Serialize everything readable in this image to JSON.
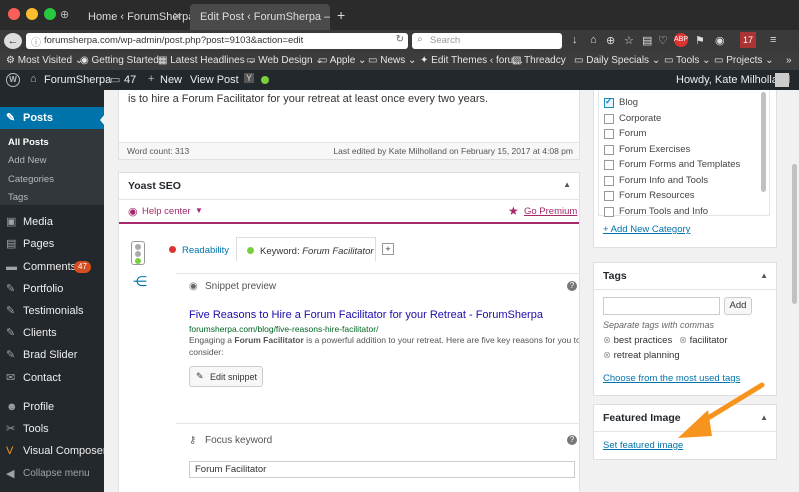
{
  "browser": {
    "tabs": [
      {
        "title": "Home ‹ ForumSherpa",
        "active": false
      },
      {
        "title": "Edit Post ‹ ForumSherpa — Wo…",
        "active": true
      }
    ],
    "url": "forumsherpa.com/wp-admin/post.php?post=9103&action=edit",
    "search_placeholder": "Search",
    "bookmarks": [
      "Most Visited",
      "Getting Started",
      "Latest Headlines",
      "Web Design",
      "Apple",
      "News",
      "Edit Themes ‹ foru…",
      "Threadcy",
      "Daily Specials",
      "Tools",
      "Projects"
    ]
  },
  "adminbar": {
    "site_name": "ForumSherpa",
    "comment_count": "47",
    "new_label": "New",
    "view_post": "View Post",
    "greeting": "Howdy, Kate Milholland"
  },
  "menu": {
    "posts": "Posts",
    "posts_sub": [
      "All Posts",
      "Add New",
      "Categories",
      "Tags"
    ],
    "media": "Media",
    "pages": "Pages",
    "comments": "Comments",
    "comments_badge": "47",
    "portfolio": "Portfolio",
    "testimonials": "Testimonials",
    "clients": "Clients",
    "brad_slider": "Brad Slider",
    "contact": "Contact",
    "profile": "Profile",
    "tools": "Tools",
    "visual_composer": "Visual Composer",
    "collapse": "Collapse menu"
  },
  "editor": {
    "body_line": "is to hire a Forum Facilitator for your retreat at least once every two years.",
    "word_count": "Word count: 313",
    "last_edited": "Last edited by Kate Milholland on February 15, 2017 at 4:08 pm"
  },
  "yoast": {
    "title": "Yoast SEO",
    "help": "Help center",
    "premium": "Go Premium",
    "tab_readability": "Readability",
    "tab_keyword_prefix": "Keyword: ",
    "tab_keyword_value": "Forum Facilitator",
    "add_tab": "+",
    "snippet_heading": "Snippet preview",
    "snippet_title": "Five Reasons to Hire a Forum Facilitator for your Retreat - ForumSherpa",
    "snippet_url": "forumsherpa.com/blog/five-reasons-hire-facilitator/",
    "snippet_desc_pre": "Engaging a ",
    "snippet_desc_bold": "Forum Facilitator",
    "snippet_desc_post": " is a powerful addition to your retreat. Here are five key reasons for you to",
    "snippet_desc_line2": "consider:",
    "edit_snippet": "Edit snippet",
    "focus_heading": "Focus keyword",
    "focus_value": "Forum Facilitator"
  },
  "categories": {
    "items": [
      {
        "label": "Blog",
        "checked": true
      },
      {
        "label": "Corporate",
        "checked": false
      },
      {
        "label": "Forum",
        "checked": false
      },
      {
        "label": "Forum Exercises",
        "checked": false
      },
      {
        "label": "Forum Forms and Templates",
        "checked": false
      },
      {
        "label": "Forum Info and Tools",
        "checked": false
      },
      {
        "label": "Forum Resources",
        "checked": false
      },
      {
        "label": "Forum Tools and Info",
        "checked": false
      }
    ],
    "add_new": "+ Add New Category"
  },
  "tags": {
    "title": "Tags",
    "add_button": "Add",
    "hint": "Separate tags with commas",
    "items": [
      "best practices",
      "facilitator",
      "retreat planning"
    ],
    "choose": "Choose from the most used tags"
  },
  "featured": {
    "title": "Featured Image",
    "set_link": "Set featured image"
  },
  "colors": {
    "wp_dark": "#23282d",
    "wp_blue": "#0073aa",
    "active_menu": "#0073aa",
    "arrow": "#f7941d",
    "yoast_purple": "#a4286a"
  }
}
